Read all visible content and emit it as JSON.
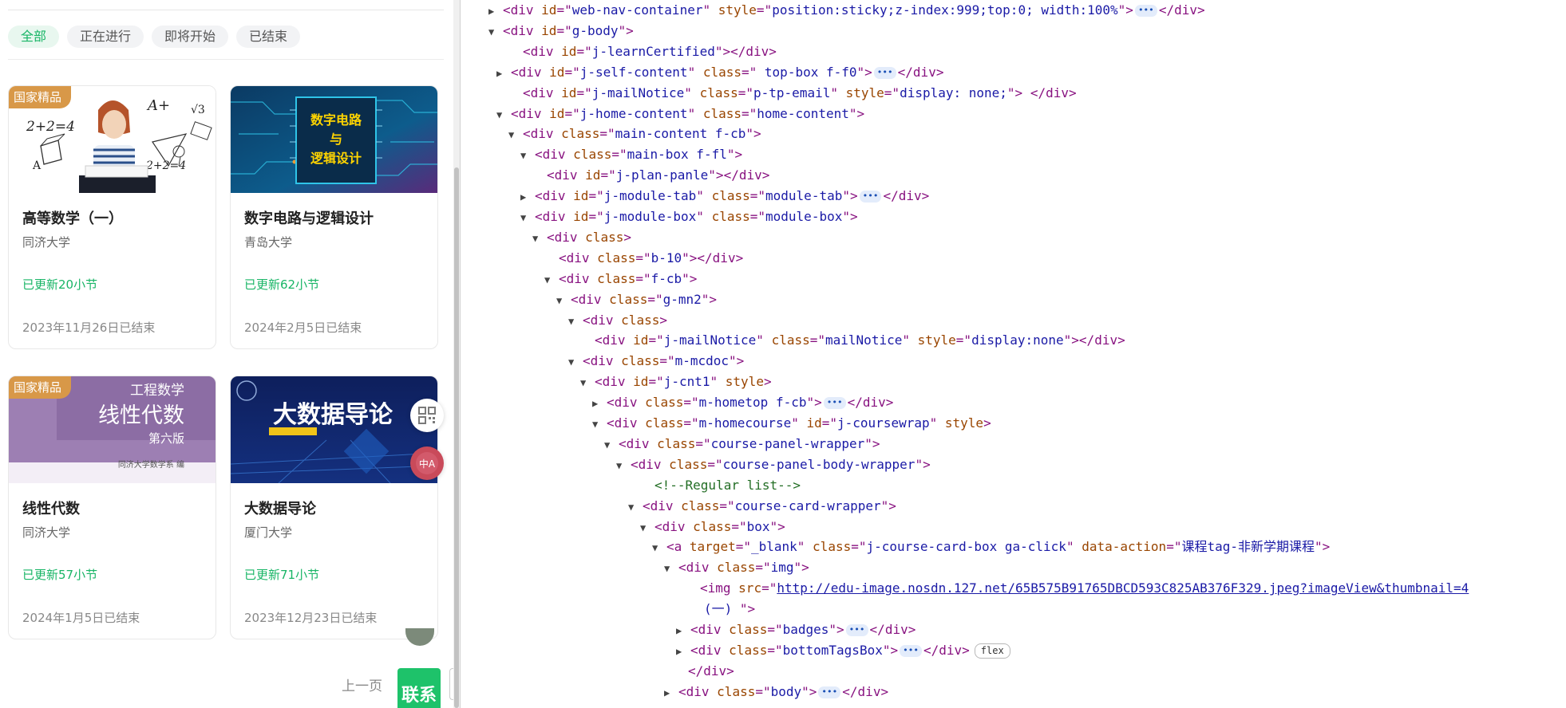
{
  "filters": {
    "items": [
      "全部",
      "正在进行",
      "即将开始",
      "已结束"
    ],
    "active": "全部"
  },
  "colors": {
    "accent": "#18b566",
    "badge": "#d89848",
    "contact": "#1ec26a"
  },
  "courses": [
    {
      "badge": "国家精品",
      "cover_text": "",
      "title": "高等数学（一）",
      "school": "同济大学",
      "update": "已更新20小节",
      "date": "2023年11月26日已结束"
    },
    {
      "badge": "",
      "cover_text": "数字电路 与 逻辑设计",
      "title": "数字电路与逻辑设计",
      "school": "青岛大学",
      "update": "已更新62小节",
      "date": "2024年2月5日已结束"
    },
    {
      "badge": "国家精品",
      "cover_text": "工程数学 线性代数 第六版 同济大学数学系 编",
      "title": "线性代数",
      "school": "同济大学",
      "update": "已更新57小节",
      "date": "2024年1月5日已结束"
    },
    {
      "badge": "",
      "cover_text": "大数据导论",
      "title": "大数据导论",
      "school": "厦门大学",
      "update": "已更新71小节",
      "date": "2023年12月23日已结束"
    }
  ],
  "covers": {
    "c1_formulas": [
      "2+2=4",
      "A+",
      "√3",
      "A",
      "2+2=4"
    ],
    "c2_lines": [
      "数字电路",
      "与",
      "逻辑设计"
    ],
    "c3_lines": [
      "工程数学",
      "线性代数",
      "第六版",
      "同济大学数学系 编"
    ],
    "c4_title": "大数据导论"
  },
  "floating": {
    "qr_icon": "qr-code-icon",
    "translate_icon": "translate-icon",
    "translate_glyph": "中A"
  },
  "pagination": {
    "prev": "上一页",
    "contact": "联系"
  },
  "devtools": {
    "lines": [
      {
        "tri": "▶",
        "html": "<span class=\"tag\">&lt;div</span> <span class=\"an\">id</span><span class=\"tag\">=\"</span><span class=\"av\">web-nav-container</span><span class=\"tag\">\"</span> <span class=\"an\">style</span><span class=\"tag\">=\"</span><span class=\"av\">position:sticky;z-index:999;top:0; width:100%</span><span class=\"tag\">\"&gt;</span><span class=\"ell\">•••</span><span class=\"tag\">&lt;/div&gt;</span>"
      },
      {
        "tri": "▼",
        "html": "<span class=\"tag\">&lt;div</span> <span class=\"an\">id</span><span class=\"tag\">=\"</span><span class=\"av\">g-body</span><span class=\"tag\">\"&gt;</span>"
      },
      {
        "tri": "",
        "html": "<span class=\"tag\">&lt;div</span> <span class=\"an\">id</span><span class=\"tag\">=\"</span><span class=\"av\">j-learnCertified</span><span class=\"tag\">\"&gt;&lt;/div&gt;</span>"
      },
      {
        "tri": "▶",
        "html": "<span class=\"tag\">&lt;div</span> <span class=\"an\">id</span><span class=\"tag\">=\"</span><span class=\"av\">j-self-content</span><span class=\"tag\">\"</span> <span class=\"an\">class</span><span class=\"tag\">=\"</span><span class=\"av\"> top-box f-f0</span><span class=\"tag\">\"&gt;</span><span class=\"ell\">•••</span><span class=\"tag\">&lt;/div&gt;</span>"
      },
      {
        "tri": "",
        "html": "<span class=\"tag\">&lt;div</span> <span class=\"an\">id</span><span class=\"tag\">=\"</span><span class=\"av\">j-mailNotice</span><span class=\"tag\">\"</span> <span class=\"an\">class</span><span class=\"tag\">=\"</span><span class=\"av\">p-tp-email</span><span class=\"tag\">\"</span> <span class=\"an\">style</span><span class=\"tag\">=\"</span><span class=\"av\">display: none;</span><span class=\"tag\">\"&gt; &lt;/div&gt;</span>"
      },
      {
        "tri": "▼",
        "html": "<span class=\"tag\">&lt;div</span> <span class=\"an\">id</span><span class=\"tag\">=\"</span><span class=\"av\">j-home-content</span><span class=\"tag\">\"</span> <span class=\"an\">class</span><span class=\"tag\">=\"</span><span class=\"av\">home-content</span><span class=\"tag\">\"&gt;</span>"
      },
      {
        "tri": "▼",
        "html": "<span class=\"tag\">&lt;div</span> <span class=\"an\">class</span><span class=\"tag\">=\"</span><span class=\"av\">main-content f-cb</span><span class=\"tag\">\"&gt;</span>"
      },
      {
        "tri": "▼",
        "html": "<span class=\"tag\">&lt;div</span> <span class=\"an\">class</span><span class=\"tag\">=\"</span><span class=\"av\">main-box f-fl</span><span class=\"tag\">\"&gt;</span>"
      },
      {
        "tri": "",
        "html": "<span class=\"tag\">&lt;div</span> <span class=\"an\">id</span><span class=\"tag\">=\"</span><span class=\"av\">j-plan-panle</span><span class=\"tag\">\"&gt;&lt;/div&gt;</span>"
      },
      {
        "tri": "▶",
        "html": "<span class=\"tag\">&lt;div</span> <span class=\"an\">id</span><span class=\"tag\">=\"</span><span class=\"av\">j-module-tab</span><span class=\"tag\">\"</span> <span class=\"an\">class</span><span class=\"tag\">=\"</span><span class=\"av\">module-tab</span><span class=\"tag\">\"&gt;</span><span class=\"ell\">•••</span><span class=\"tag\">&lt;/div&gt;</span>"
      },
      {
        "tri": "▼",
        "html": "<span class=\"tag\">&lt;div</span> <span class=\"an\">id</span><span class=\"tag\">=\"</span><span class=\"av\">j-module-box</span><span class=\"tag\">\"</span> <span class=\"an\">class</span><span class=\"tag\">=\"</span><span class=\"av\">module-box</span><span class=\"tag\">\"&gt;</span>"
      },
      {
        "tri": "▼",
        "html": "<span class=\"tag\">&lt;div</span> <span class=\"an\">class</span><span class=\"tag\">&gt;</span>"
      },
      {
        "tri": "",
        "html": "<span class=\"tag\">&lt;div</span> <span class=\"an\">class</span><span class=\"tag\">=\"</span><span class=\"av\">b-10</span><span class=\"tag\">\"&gt;&lt;/div&gt;</span>"
      },
      {
        "tri": "▼",
        "html": "<span class=\"tag\">&lt;div</span> <span class=\"an\">class</span><span class=\"tag\">=\"</span><span class=\"av\">f-cb</span><span class=\"tag\">\"&gt;</span>"
      },
      {
        "tri": "▼",
        "html": "<span class=\"tag\">&lt;div</span> <span class=\"an\">class</span><span class=\"tag\">=\"</span><span class=\"av\">g-mn2</span><span class=\"tag\">\"&gt;</span>"
      },
      {
        "tri": "▼",
        "html": "<span class=\"tag\">&lt;div</span> <span class=\"an\">class</span><span class=\"tag\">&gt;</span>"
      },
      {
        "tri": "",
        "html": "<span class=\"tag\">&lt;div</span> <span class=\"an\">id</span><span class=\"tag\">=\"</span><span class=\"av\">j-mailNotice</span><span class=\"tag\">\"</span> <span class=\"an\">class</span><span class=\"tag\">=\"</span><span class=\"av\">mailNotice</span><span class=\"tag\">\"</span> <span class=\"an\">style</span><span class=\"tag\">=\"</span><span class=\"av\">display:none</span><span class=\"tag\">\"&gt;&lt;/div&gt;</span>"
      },
      {
        "tri": "▼",
        "html": "<span class=\"tag\">&lt;div</span> <span class=\"an\">class</span><span class=\"tag\">=\"</span><span class=\"av\">m-mcdoc</span><span class=\"tag\">\"&gt;</span>"
      },
      {
        "tri": "▼",
        "html": "<span class=\"tag\">&lt;div</span> <span class=\"an\">id</span><span class=\"tag\">=\"</span><span class=\"av\">j-cnt1</span><span class=\"tag\">\"</span> <span class=\"an\">style</span><span class=\"tag\">&gt;</span>"
      },
      {
        "tri": "▶",
        "html": "<span class=\"tag\">&lt;div</span> <span class=\"an\">class</span><span class=\"tag\">=\"</span><span class=\"av\">m-hometop f-cb</span><span class=\"tag\">\"&gt;</span><span class=\"ell\">•••</span><span class=\"tag\">&lt;/div&gt;</span>"
      },
      {
        "tri": "▼",
        "html": "<span class=\"tag\">&lt;div</span> <span class=\"an\">class</span><span class=\"tag\">=\"</span><span class=\"av\">m-homecourse</span><span class=\"tag\">\"</span> <span class=\"an\">id</span><span class=\"tag\">=\"</span><span class=\"av\">j-coursewrap</span><span class=\"tag\">\"</span> <span class=\"an\">style</span><span class=\"tag\">&gt;</span>"
      },
      {
        "tri": "▼",
        "html": "<span class=\"tag\">&lt;div</span> <span class=\"an\">class</span><span class=\"tag\">=\"</span><span class=\"av\">course-panel-wrapper</span><span class=\"tag\">\"&gt;</span>"
      },
      {
        "tri": "▼",
        "html": "<span class=\"tag\">&lt;div</span> <span class=\"an\">class</span><span class=\"tag\">=\"</span><span class=\"av\">course-panel-body-wrapper</span><span class=\"tag\">\"&gt;</span>"
      },
      {
        "tri": "",
        "html": "<span class=\"cm\">&lt;!--Regular list--&gt;</span>"
      },
      {
        "tri": "▼",
        "html": "<span class=\"tag\">&lt;div</span> <span class=\"an\">class</span><span class=\"tag\">=\"</span><span class=\"av\">course-card-wrapper</span><span class=\"tag\">\"&gt;</span>"
      },
      {
        "tri": "▼",
        "html": "<span class=\"tag\">&lt;div</span> <span class=\"an\">class</span><span class=\"tag\">=\"</span><span class=\"av\">box</span><span class=\"tag\">\"&gt;</span>"
      },
      {
        "tri": "▼",
        "html": "<span class=\"tag\">&lt;a</span> <span class=\"an\">target</span><span class=\"tag\">=\"</span><span class=\"av\">_blank</span><span class=\"tag\">\"</span> <span class=\"an\">class</span><span class=\"tag\">=\"</span><span class=\"av\">j-course-card-box ga-click</span><span class=\"tag\">\"</span> <span class=\"an\">data-action</span><span class=\"tag\">=\"</span><span class=\"av\">课程tag-非新学期课程</span><span class=\"tag\">\"&gt;</span>"
      },
      {
        "tri": "▼",
        "html": "<span class=\"tag\">&lt;div</span> <span class=\"an\">class</span><span class=\"tag\">=\"</span><span class=\"av\">img</span><span class=\"tag\">\"&gt;</span>"
      },
      {
        "tri": "",
        "html": "<span class=\"tag\">&lt;img</span> <span class=\"an\">src</span><span class=\"tag\">=\"</span><span class=\"av\"><a>http://edu-image.nosdn.127.net/65B575B91765DBCD593C825AB376F329.jpeg?imageView&amp;thumbnail=4</a></span>"
      },
      {
        "tri": "",
        "html": "<span class=\"av\">(一) </span><span class=\"tag\">\"&gt;</span>"
      },
      {
        "tri": "▶",
        "html": "<span class=\"tag\">&lt;div</span> <span class=\"an\">class</span><span class=\"tag\">=\"</span><span class=\"av\">badges</span><span class=\"tag\">\"&gt;</span><span class=\"ell\">•••</span><span class=\"tag\">&lt;/div&gt;</span>"
      },
      {
        "tri": "▶",
        "html": "<span class=\"tag\">&lt;div</span> <span class=\"an\">class</span><span class=\"tag\">=\"</span><span class=\"av\">bottomTagsBox</span><span class=\"tag\">\"&gt;</span><span class=\"ell\">•••</span><span class=\"tag\">&lt;/div&gt;</span><span class=\"flexbadge\">flex</span>"
      },
      {
        "tri": "",
        "html": "<span class=\"tag\">&lt;/div&gt;</span>"
      },
      {
        "tri": "▶",
        "html": "<span class=\"tag\">&lt;div</span> <span class=\"an\">class</span><span class=\"tag\">=\"</span><span class=\"av\">body</span><span class=\"tag\">\"&gt;</span><span class=\"ell\">•••</span><span class=\"tag\">&lt;/div&gt;</span>"
      }
    ]
  }
}
